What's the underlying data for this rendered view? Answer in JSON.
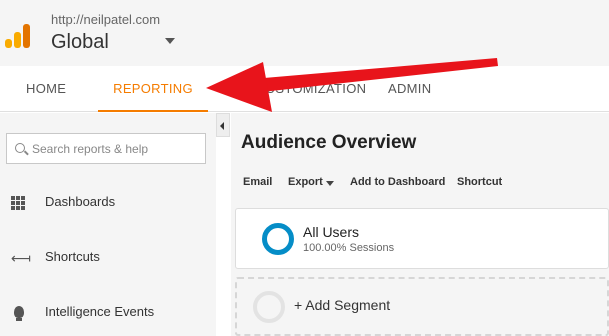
{
  "header": {
    "account_url": "http://neilpatel.com",
    "account_name": "Global"
  },
  "nav": {
    "tabs": [
      {
        "label": "HOME",
        "active": false
      },
      {
        "label": "REPORTING",
        "active": true
      },
      {
        "label": "CUSTOMIZATION",
        "active": false
      },
      {
        "label": "ADMIN",
        "active": false
      }
    ]
  },
  "sidebar": {
    "search_placeholder": "Search reports & help",
    "items": [
      {
        "label": "Dashboards",
        "icon": "grid-icon"
      },
      {
        "label": "Shortcuts",
        "icon": "shortcut-arrow-icon"
      },
      {
        "label": "Intelligence Events",
        "icon": "lightbulb-icon"
      }
    ]
  },
  "main": {
    "title": "Audience Overview",
    "toolbar": {
      "email": "Email",
      "export": "Export",
      "add_to_dashboard": "Add to Dashboard",
      "shortcut": "Shortcut"
    },
    "segment": {
      "name": "All Users",
      "sub": "100.00% Sessions"
    },
    "add_segment": "+ Add Segment"
  },
  "colors": {
    "accent": "#f57c00",
    "segment_ring": "#058dc7",
    "arrow": "#e8141b"
  }
}
